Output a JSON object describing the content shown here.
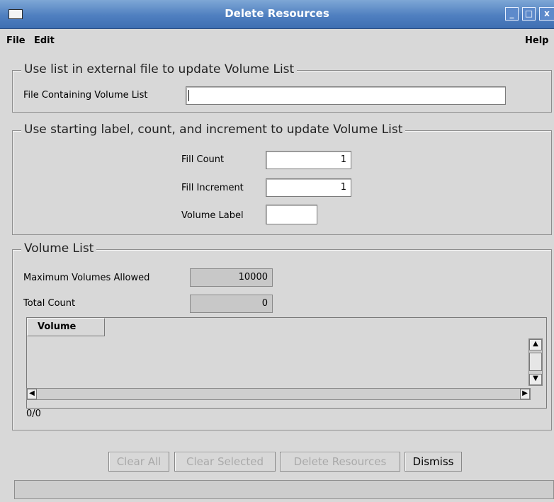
{
  "window": {
    "title": "Delete Resources",
    "minimize_glyph": "_",
    "maximize_glyph": "□",
    "close_glyph": "x"
  },
  "menubar": {
    "file": "File",
    "edit": "Edit",
    "help": "Help"
  },
  "external_file_section": {
    "title": "Use list in external file to update Volume List",
    "file_label": "File Containing Volume List",
    "file_value": ""
  },
  "fill_section": {
    "title": "Use starting label, count, and increment to update Volume List",
    "fill_count_label": "Fill Count",
    "fill_count_value": "1",
    "fill_increment_label": "Fill Increment",
    "fill_increment_value": "1",
    "volume_label_label": "Volume Label",
    "volume_label_value": ""
  },
  "volume_list_section": {
    "title": "Volume List",
    "max_label": "Maximum Volumes Allowed",
    "max_value": "10000",
    "total_label": "Total Count",
    "total_value": "0",
    "columns": [
      "Volume"
    ],
    "rows": [],
    "position": "0/0"
  },
  "buttons": {
    "clear_all": "Clear All",
    "clear_selected": "Clear Selected",
    "delete_resources": "Delete Resources",
    "dismiss": "Dismiss"
  },
  "status": {
    "text": ""
  },
  "colors": {
    "titlebar": "#4f7fc0",
    "background": "#d8d8d8",
    "disabled_text": "#a9a9a9"
  }
}
